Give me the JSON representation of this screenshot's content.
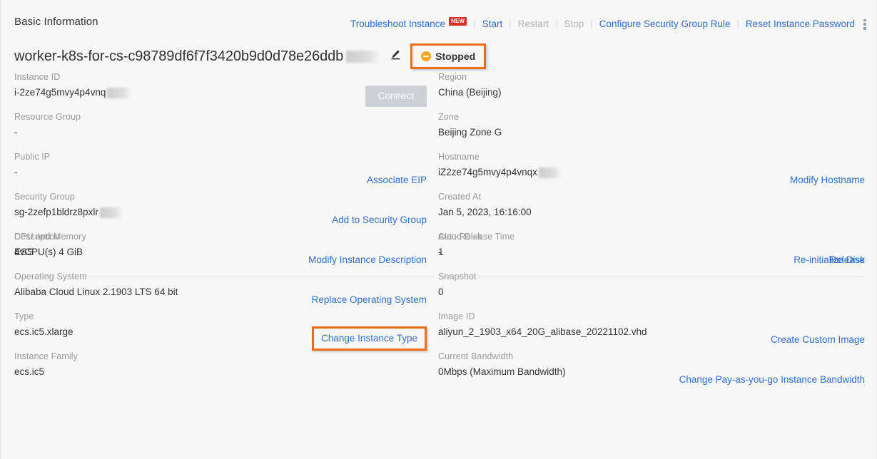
{
  "panel": {
    "title": "Basic Information"
  },
  "header_actions": {
    "troubleshoot": "Troubleshoot Instance",
    "new_badge": "NEW",
    "start": "Start",
    "restart": "Restart",
    "stop": "Stop",
    "configure_sg": "Configure Security Group Rule",
    "reset_password": "Reset Instance Password",
    "more_icon": "more-vertical-icon",
    "separator": "|"
  },
  "instance": {
    "name": "worker-k8s-for-cs-c98789df6f7f3420b9d0d78e26ddb",
    "edit_icon": "pencil-icon",
    "status": "Stopped",
    "status_icon": "minus-circle-icon",
    "status_color": "#f5a623",
    "highlight_color": "#ef6c16"
  },
  "section1": {
    "left": [
      {
        "label": "Instance ID",
        "value": "i-2ze74g5mvy4p4vnq",
        "redacted": true,
        "action": "Connect",
        "action_type": "button-disabled"
      },
      {
        "label": "Resource Group",
        "value": "-",
        "redacted": false,
        "action": "",
        "action_type": "none"
      },
      {
        "label": "Public IP",
        "value": "-",
        "redacted": false,
        "action": "Associate EIP",
        "action_type": "link"
      },
      {
        "label": "Security Group",
        "value": "sg-2zefp1bldrz8pxlr",
        "redacted": true,
        "action": "Add to Security Group",
        "action_type": "link"
      },
      {
        "label": "Description",
        "value": "ESS",
        "redacted": false,
        "action": "Modify Instance Description",
        "action_type": "link"
      }
    ],
    "right": [
      {
        "label": "Region",
        "value": "China (Beijing)",
        "redacted": false,
        "action": "",
        "action_type": "none"
      },
      {
        "label": "Zone",
        "value": "Beijing Zone G",
        "redacted": false,
        "action": "",
        "action_type": "none"
      },
      {
        "label": "Hostname",
        "value": "iZ2ze74g5mvy4p4vnqx",
        "redacted": true,
        "action": "Modify Hostname",
        "action_type": "link"
      },
      {
        "label": "Created At",
        "value": "Jan 5, 2023, 16:16:00",
        "redacted": false,
        "action": "",
        "action_type": "none"
      },
      {
        "label": "Auto Release Time",
        "value": "-",
        "redacted": false,
        "action": "Release",
        "action_type": "link"
      }
    ]
  },
  "section2": {
    "left": [
      {
        "label": "CPU and Memory",
        "value": "4vCPU(s) 4 GiB",
        "action": "",
        "action_type": "none"
      },
      {
        "label": "Operating System",
        "value": "Alibaba Cloud Linux 2.1903 LTS 64 bit",
        "action": "Replace Operating System",
        "action_type": "link"
      },
      {
        "label": "Type",
        "value": "ecs.ic5.xlarge",
        "action": "Change Instance Type",
        "action_type": "link-highlighted"
      },
      {
        "label": "Instance Family",
        "value": "ecs.ic5",
        "action": "",
        "action_type": "none"
      }
    ],
    "right": [
      {
        "label": "Cloud Disk",
        "value": "1",
        "action": "Re-initialize Disk",
        "action_type": "link"
      },
      {
        "label": "Snapshot",
        "value": "0",
        "action": "",
        "action_type": "none"
      },
      {
        "label": "Image ID",
        "value": "aliyun_2_1903_x64_20G_alibase_20221102.vhd",
        "action": "Create Custom Image",
        "action_type": "link"
      },
      {
        "label": "Current Bandwidth",
        "value": "0Mbps (Maximum Bandwidth)",
        "action": "Change Pay-as-you-go Instance Bandwidth",
        "action_type": "link"
      }
    ]
  }
}
